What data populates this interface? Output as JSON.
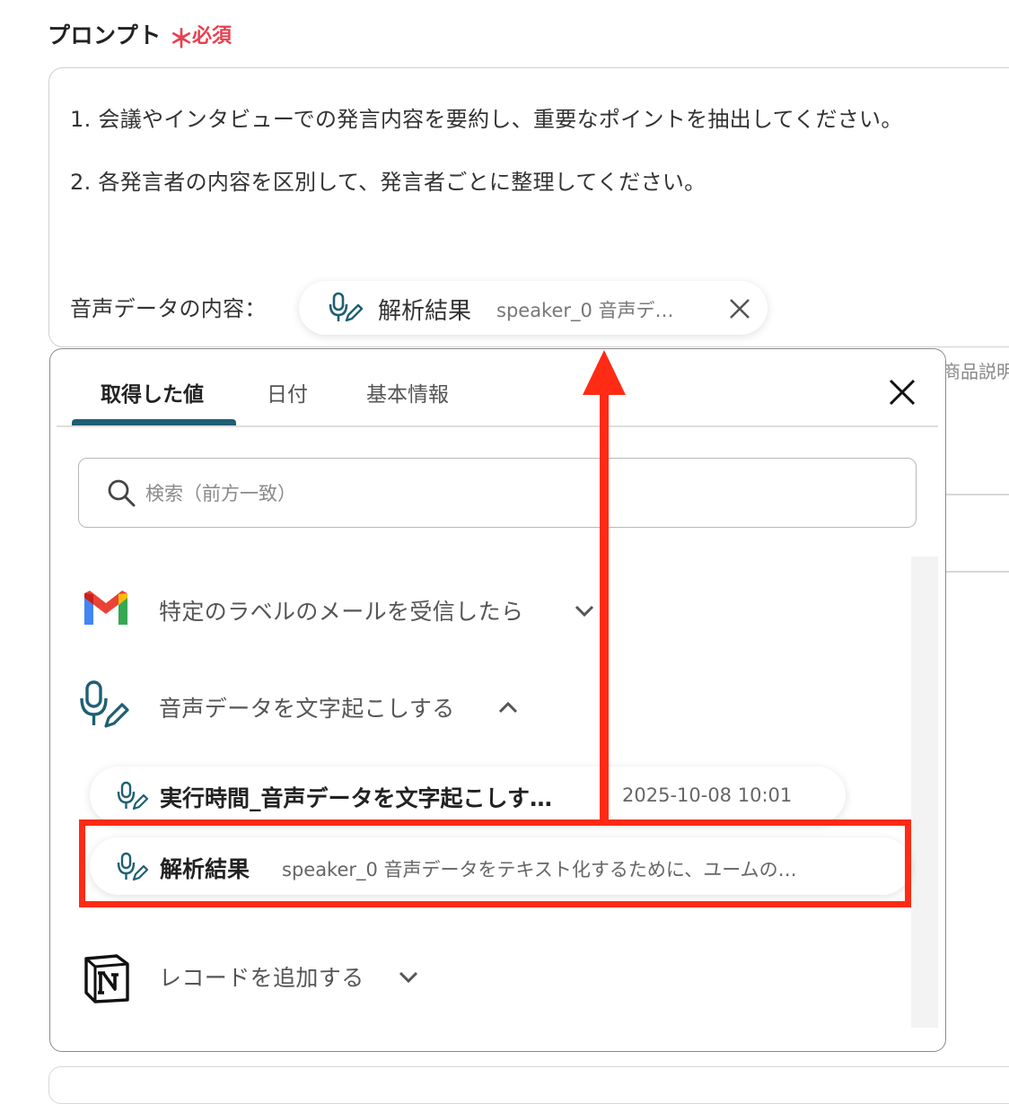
{
  "field": {
    "label": "プロンプト",
    "required_star": "＊",
    "required_text": "必須"
  },
  "prompt": {
    "line1": "1. 会議やインタビューでの発言内容を要約し、重要なポイントを抽出してください。",
    "line2": "2. 各発言者の内容を区別して、発言者ごとに整理してください。",
    "line3": "音声データの内容："
  },
  "selected_pill": {
    "icon": "mic-pen-icon",
    "title": "解析結果",
    "subtitle": "speaker_0 音声デ…"
  },
  "background": {
    "partial_text": "商品説明"
  },
  "popup": {
    "tabs": [
      {
        "label": "取得した値",
        "active": true
      },
      {
        "label": "日付",
        "active": false
      },
      {
        "label": "基本情報",
        "active": false
      }
    ],
    "search": {
      "placeholder": "検索（前方一致）",
      "value": ""
    },
    "sections": [
      {
        "icon": "gmail-icon",
        "label": "特定のラベルのメールを受信したら",
        "expanded": false
      },
      {
        "icon": "mic-pen-icon",
        "label": "音声データを文字起こしする",
        "expanded": true,
        "items": [
          {
            "title": "実行時間_音声データを文字起こしす…",
            "value": "2025-10-08 10:01"
          },
          {
            "title": "解析結果",
            "value": "speaker_0 音声データをテキスト化するために、ユームの…"
          }
        ]
      },
      {
        "icon": "notion-icon",
        "label": "レコードを追加する",
        "expanded": false
      }
    ]
  },
  "colors": {
    "accent_tab": "#1f5f73",
    "required": "#e8404f",
    "annotation": "#ff2b15",
    "icon_teal": "#1f5f73"
  }
}
